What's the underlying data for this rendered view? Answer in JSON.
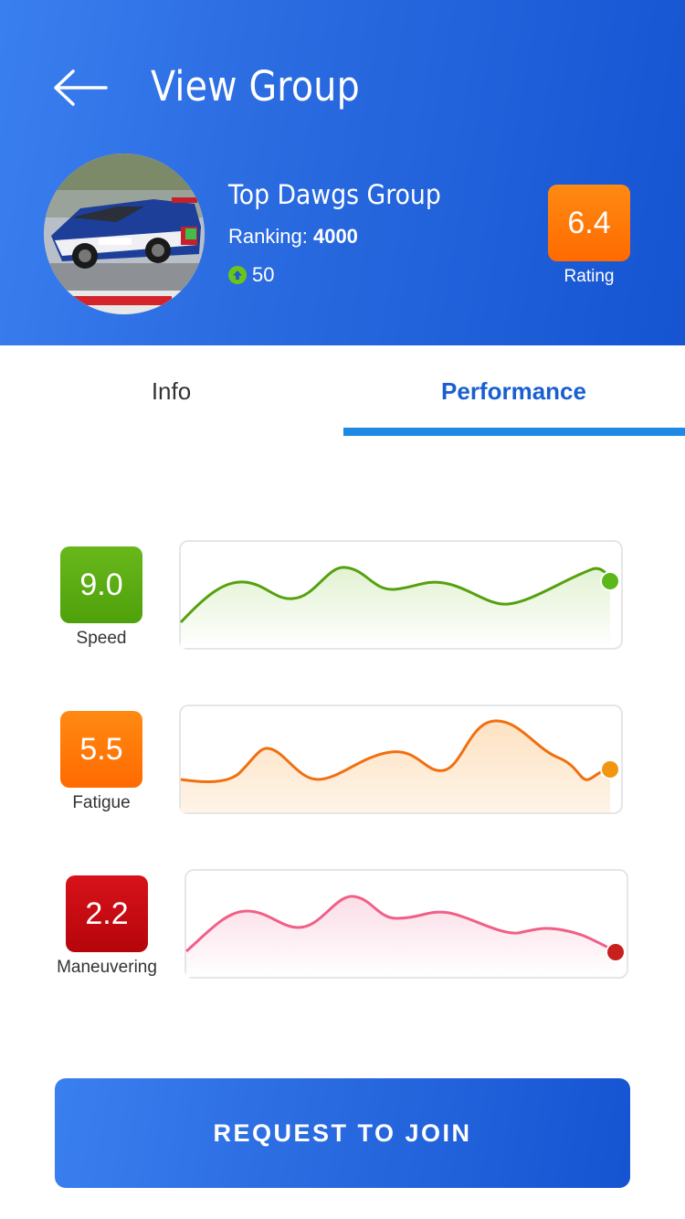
{
  "header": {
    "title": "View Group",
    "back_icon": "arrow-left-icon"
  },
  "group": {
    "name": "Top Dawgs Group",
    "ranking_label": "Ranking:",
    "ranking_value": "4000",
    "upvotes": "50",
    "upvote_icon": "arrow-up-circle-icon",
    "rating_value": "6.4",
    "rating_label": "Rating",
    "rating_color": "#ff7a0a"
  },
  "tabs": [
    {
      "label": "Info",
      "active": false
    },
    {
      "label": "Performance",
      "active": true
    }
  ],
  "metrics": [
    {
      "label": "Speed",
      "value": "9.0",
      "color": "#5aab12",
      "line_color": "#55a10f",
      "fill_color": "#e9f5dd",
      "dot_color": "#5cb81a"
    },
    {
      "label": "Fatigue",
      "value": "5.5",
      "color": "#ff7a0a",
      "line_color": "#f07010",
      "fill_color": "#fde9d2",
      "dot_color": "#f29612"
    },
    {
      "label": "Maneuvering",
      "value": "2.2",
      "color": "#c8090e",
      "line_color": "#f06088",
      "fill_color": "#fde6ee",
      "dot_color": "#c8201e"
    }
  ],
  "actions": {
    "join_label": "REQUEST TO JOIN"
  },
  "colors": {
    "primary": "#1a5fd0",
    "tab_indicator": "#1e88e5"
  }
}
